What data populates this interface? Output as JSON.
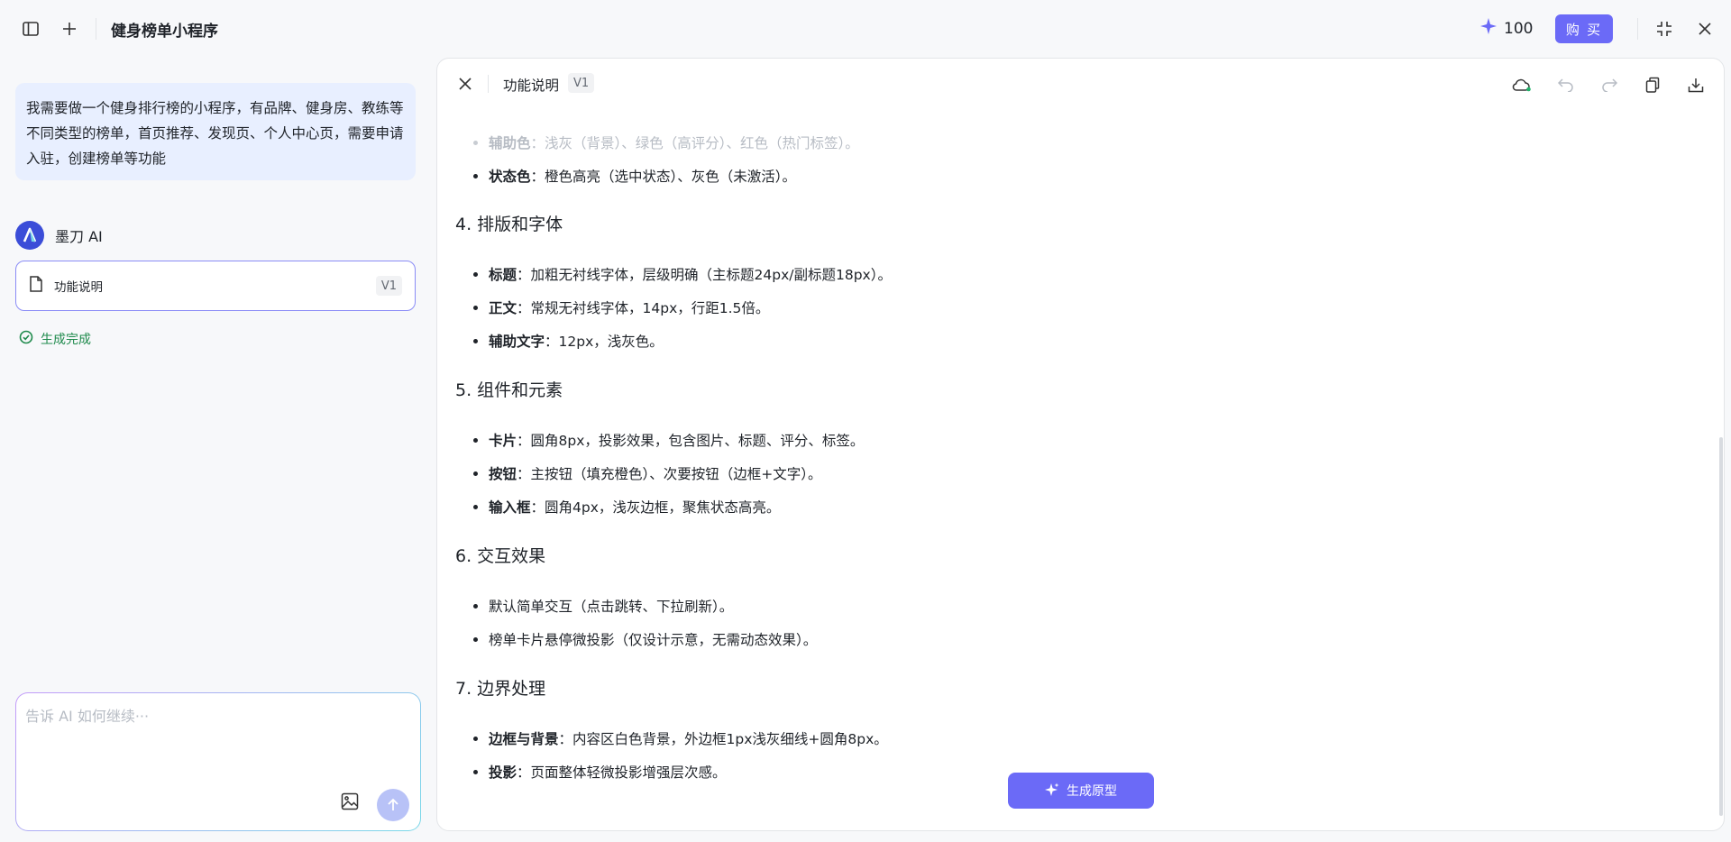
{
  "app": {
    "title": "健身榜单小程序"
  },
  "header": {
    "credits": "100",
    "buy_label": "购 买"
  },
  "chat": {
    "user_message": "我需要做一个健身排行榜的小程序，有品牌、健身房、教练等不同类型的榜单，首页推荐、发现页、个人中心页，需要申请入驻，创建榜单等功能",
    "ai_name": "墨刀 AI",
    "doc_card": {
      "label": "功能说明",
      "version": "V1"
    },
    "status": "生成完成",
    "input_placeholder": "告诉 AI 如何继续···"
  },
  "document": {
    "title": "功能说明",
    "version": "V1",
    "top_items": [
      {
        "term": "辅助色",
        "text": "：浅灰（背景）、绿色（高评分）、红色（热门标签）。"
      },
      {
        "term": "状态色",
        "text": "：橙色高亮（选中状态）、灰色（未激活）。"
      }
    ],
    "sections": [
      {
        "title": "4. 排版和字体",
        "items": [
          {
            "term": "标题",
            "text": "：加粗无衬线字体，层级明确（主标题24px/副标题18px）。"
          },
          {
            "term": "正文",
            "text": "：常规无衬线字体，14px，行距1.5倍。"
          },
          {
            "term": "辅助文字",
            "text": "：12px，浅灰色。"
          }
        ]
      },
      {
        "title": "5. 组件和元素",
        "items": [
          {
            "term": "卡片",
            "text": "：圆角8px，投影效果，包含图片、标题、评分、标签。"
          },
          {
            "term": "按钮",
            "text": "：主按钮（填充橙色）、次要按钮（边框+文字）。"
          },
          {
            "term": "输入框",
            "text": "：圆角4px，浅灰边框，聚焦状态高亮。"
          }
        ]
      },
      {
        "title": "6. 交互效果",
        "items": [
          {
            "term": "",
            "text": "默认简单交互（点击跳转、下拉刷新）。"
          },
          {
            "term": "",
            "text": "榜单卡片悬停微投影（仅设计示意，无需动态效果）。"
          }
        ]
      },
      {
        "title": "7. 边界处理",
        "items": [
          {
            "term": "边框与背景",
            "text": "：内容区白色背景，外边框1px浅灰细线+圆角8px。"
          },
          {
            "term": "投影",
            "text": "：页面整体轻微投影增强层次感。"
          }
        ]
      }
    ],
    "generate_button": "生成原型"
  },
  "colors": {
    "accent": "#6b6af7",
    "success": "#1f8a4c",
    "chat_bubble": "#e8efff"
  }
}
